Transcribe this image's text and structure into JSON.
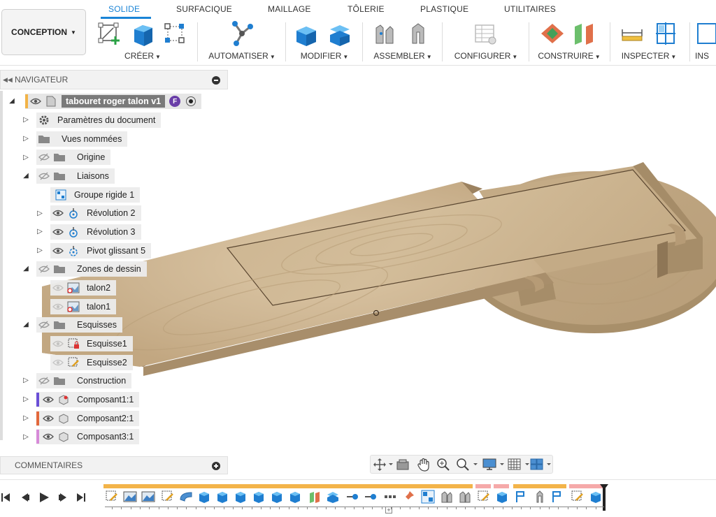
{
  "workspace": {
    "label": "CONCEPTION"
  },
  "tabs": [
    {
      "label": "SOLIDE",
      "active": true
    },
    {
      "label": "SURFACIQUE"
    },
    {
      "label": "MAILLAGE"
    },
    {
      "label": "TÔLERIE"
    },
    {
      "label": "PLASTIQUE"
    },
    {
      "label": "UTILITAIRES"
    }
  ],
  "groups": {
    "create": "CRÉER",
    "automate": "AUTOMATISER",
    "modify": "MODIFIER",
    "assemble": "ASSEMBLER",
    "configure": "CONFIGURER",
    "construct": "CONSTRUIRE",
    "inspect": "INSPECTER",
    "insert": "INS"
  },
  "navigator": {
    "title": "NAVIGATEUR",
    "root": {
      "label": "tabouret roger talon v1",
      "badge": "F"
    },
    "items": [
      {
        "label": "Paramètres du document"
      },
      {
        "label": "Vues nommées"
      },
      {
        "label": "Origine"
      },
      {
        "label": "Liaisons"
      },
      {
        "label": "Groupe rigide 1"
      },
      {
        "label": "Révolution 2"
      },
      {
        "label": "Révolution 3"
      },
      {
        "label": "Pivot glissant 5"
      },
      {
        "label": "Zones de dessin"
      },
      {
        "label": "talon2"
      },
      {
        "label": "talon1"
      },
      {
        "label": "Esquisses"
      },
      {
        "label": "Esquisse1"
      },
      {
        "label": "Esquisse2"
      },
      {
        "label": "Construction"
      },
      {
        "label": "Composant1:1",
        "color": "#6a4fd6"
      },
      {
        "label": "Composant2:1",
        "color": "#e2683c"
      },
      {
        "label": "Composant3:1",
        "color": "#d78ad8"
      }
    ]
  },
  "comments": {
    "title": "COMMENTAIRES"
  },
  "icons": [
    "eye-icon",
    "eye-hidden-icon",
    "gear-icon",
    "folder-icon",
    "joint-icon",
    "revolute-icon",
    "sketch-icon",
    "canvas-icon",
    "component-icon",
    "orbit-icon",
    "pan-icon",
    "zoom-icon",
    "display-icon",
    "grid-icon",
    "viewport-icon",
    "play-icon",
    "previous-icon",
    "next-icon",
    "first-icon",
    "last-icon"
  ],
  "colors": {
    "accent": "#1a84d6",
    "wood": "#c8b18f",
    "timeline_orange": "#f3b449",
    "timeline_pink": "#f5a9a9"
  }
}
